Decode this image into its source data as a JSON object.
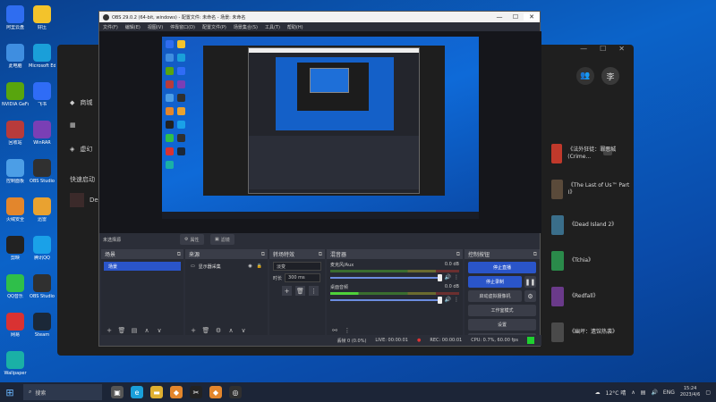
{
  "desktop": {
    "icons": [
      {
        "label": "阿里云盘",
        "icon": "aliyun-drive-icon",
        "color": "#2f6df0"
      },
      {
        "label": "好压",
        "icon": "haozip-icon",
        "color": "#f3c32b"
      },
      {
        "label": "此电脑",
        "icon": "this-pc-icon",
        "color": "#3f8ee0"
      },
      {
        "label": "Microsoft Edge",
        "icon": "edge-icon",
        "color": "#1a9fd9"
      },
      {
        "label": "NVIDIA GeForce",
        "icon": "nvidia-icon",
        "color": "#58a50e"
      },
      {
        "label": "飞书",
        "icon": "feishu-icon",
        "color": "#2f6cf6"
      },
      {
        "label": "回收站",
        "icon": "recycle-bin-icon",
        "color": "#b83b3b"
      },
      {
        "label": "WinRAR",
        "icon": "winrar-icon",
        "color": "#7a3fb5"
      },
      {
        "label": "控制面板",
        "icon": "control-panel-icon",
        "color": "#4c9ee6"
      },
      {
        "label": "OBS Studio",
        "icon": "obs-icon",
        "color": "#303030"
      },
      {
        "label": "火绒安全",
        "icon": "huorong-icon",
        "color": "#e3862c"
      },
      {
        "label": "迅雷",
        "icon": "xunlei-icon",
        "color": "#e9a230"
      },
      {
        "label": "剪映",
        "icon": "jianying-icon",
        "color": "#222"
      },
      {
        "label": "腾讯QQ",
        "icon": "qq-icon",
        "color": "#1aa1e8"
      },
      {
        "label": "QQ音乐",
        "icon": "qqmusic-icon",
        "color": "#2fbf4a"
      },
      {
        "label": "OBS Studio",
        "icon": "obs-icon",
        "color": "#303030"
      },
      {
        "label": "网易",
        "icon": "netease-icon",
        "color": "#d93232"
      },
      {
        "label": "Steam",
        "icon": "steam-icon",
        "color": "#1b2838"
      },
      {
        "label": "Wallpaper",
        "icon": "wallpaper-icon",
        "color": "#1ab0a6"
      }
    ]
  },
  "launcher": {
    "home_label": "商城",
    "library_label": "虚幻",
    "quick_label": "快速启动",
    "recent_game": "Death",
    "user_initial": "李",
    "games": [
      {
        "name": "《法外狂徒：罪恶城 (Crime...",
        "color": "#c0392b"
      },
      {
        "name": "《The Last of Us™ Part I》",
        "color": "#5a4a3a"
      },
      {
        "name": "《Dead Island 2》",
        "color": "#3a6e8a"
      },
      {
        "name": "《Tchia》",
        "color": "#2a8a4a"
      },
      {
        "name": "《Redfall》",
        "color": "#6a3a8a"
      },
      {
        "name": "《幽坪：遗馆热袭》",
        "color": "#4a4a4a"
      }
    ]
  },
  "obs": {
    "title": "OBS 29.0.2 (64-bit, windows) - 配置文件: 未命名 - 场景: 未命名",
    "menu": [
      "文件(F)",
      "编辑(E)",
      "视图(V)",
      "停靠窗口(D)",
      "配置文件(P)",
      "场景集合(S)",
      "工具(T)",
      "帮助(H)"
    ],
    "scene_name": "未选择源",
    "tab_properties": "属性",
    "tab_filters": "滤镜",
    "scenes": {
      "title": "场景",
      "items": [
        "场景"
      ]
    },
    "sources": {
      "title": "来源",
      "items": [
        {
          "name": "显示器采集"
        }
      ]
    },
    "transitions": {
      "title": "转场特效",
      "type": "淡变",
      "duration_label": "时长",
      "duration": "300 ms"
    },
    "mixer": {
      "title": "混音器",
      "channels": [
        {
          "name": "麦克风/Aux",
          "db": "0.0 dB"
        },
        {
          "name": "桌面音频",
          "db": "0.0 dB"
        }
      ]
    },
    "controls": {
      "title": "控制按钮",
      "start_stream": "停止直播",
      "stop_record": "停止录制",
      "virtual_cam": "启动虚拟摄像机",
      "studio_mode": "工作室模式",
      "settings": "设置",
      "exit": "退出"
    },
    "status": {
      "dropped": "丢帧 0 (0.0%)",
      "live": "LIVE: 00:00:01",
      "rec": "REC: 00:00:01",
      "cpu": "CPU: 0.7%, 60.00 fps"
    }
  },
  "taskbar": {
    "search_placeholder": "搜索",
    "weather": "12°C 晴",
    "lang": "ENG",
    "time": "15:24",
    "date": "2023/4/6"
  }
}
